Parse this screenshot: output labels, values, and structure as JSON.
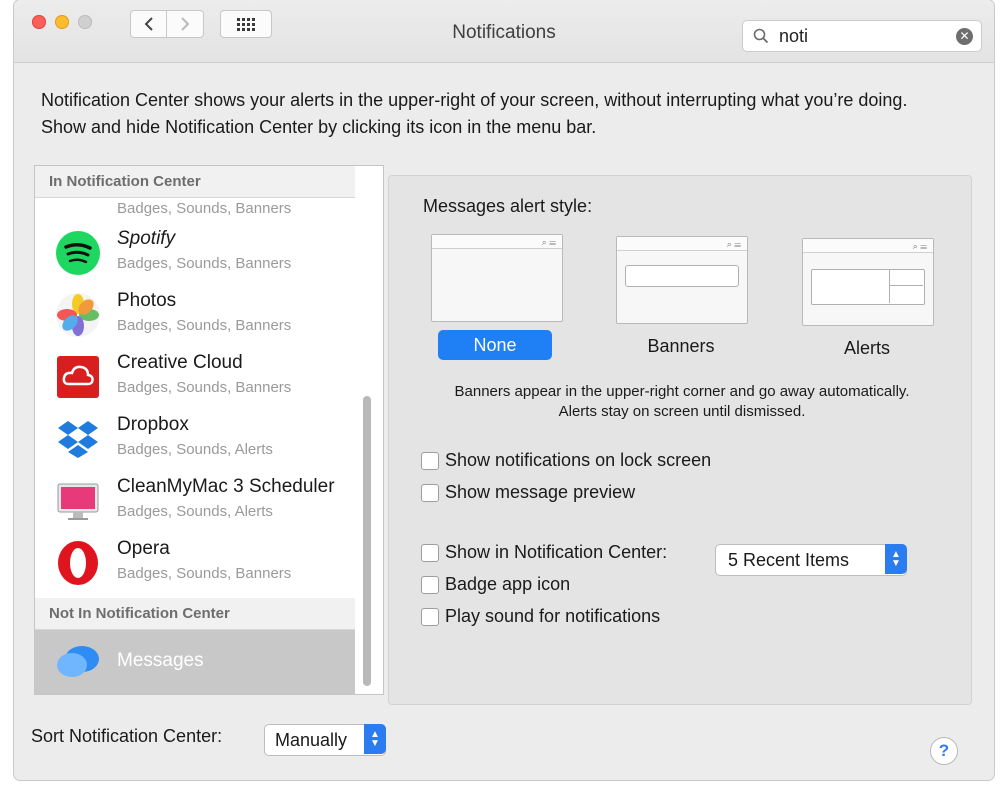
{
  "window": {
    "title": "Notifications"
  },
  "search": {
    "query": "noti"
  },
  "intro_text": "Notification Center shows your alerts in the upper-right of your screen, without interrupting what you’re doing. Show and hide Notification Center by clicking its icon in the menu bar.",
  "sidebar": {
    "in_header": "In Notification Center",
    "not_in_header": "Not In Notification Center",
    "partial_app": {
      "sub": "Badges, Sounds, Banners"
    },
    "apps": [
      {
        "name": "Spotify",
        "sub": "Badges, Sounds, Banners",
        "icon": "spotify-icon"
      },
      {
        "name": "Photos",
        "sub": "Badges, Sounds, Banners",
        "icon": "photos-icon"
      },
      {
        "name": "Creative Cloud",
        "sub": "Badges, Sounds, Banners",
        "icon": "creative-cloud-icon"
      },
      {
        "name": "Dropbox",
        "sub": "Badges, Sounds, Alerts",
        "icon": "dropbox-icon"
      },
      {
        "name": "CleanMyMac 3 Scheduler",
        "sub": "Badges, Sounds, Alerts",
        "icon": "cleanmymac-icon"
      },
      {
        "name": "Opera",
        "sub": "Badges, Sounds, Banners",
        "icon": "opera-icon"
      }
    ],
    "not_in_apps": [
      {
        "name": "Messages",
        "icon": "messages-icon",
        "selected": true
      }
    ]
  },
  "panel": {
    "alert_style_label": "Messages alert style:",
    "styles": [
      {
        "label": "None",
        "selected": true
      },
      {
        "label": "Banners",
        "selected": false
      },
      {
        "label": "Alerts",
        "selected": false
      }
    ],
    "description": "Banners appear in the upper-right corner and go away automatically. Alerts stay on screen until dismissed.",
    "options": {
      "lock_screen": {
        "label": "Show notifications on lock screen",
        "checked": false
      },
      "message_preview": {
        "label": "Show message preview",
        "checked": false
      },
      "show_in_nc": {
        "label": "Show in Notification Center:",
        "checked": false,
        "value": "5 Recent Items"
      },
      "badge": {
        "label": "Badge app icon",
        "checked": false
      },
      "sound": {
        "label": "Play sound for notifications",
        "checked": false
      }
    }
  },
  "footer": {
    "sort_label": "Sort Notification Center:",
    "sort_value": "Manually",
    "help": "?"
  },
  "colors": {
    "accent": "#1f7ff5",
    "selected_row": "#c8c8c8"
  }
}
